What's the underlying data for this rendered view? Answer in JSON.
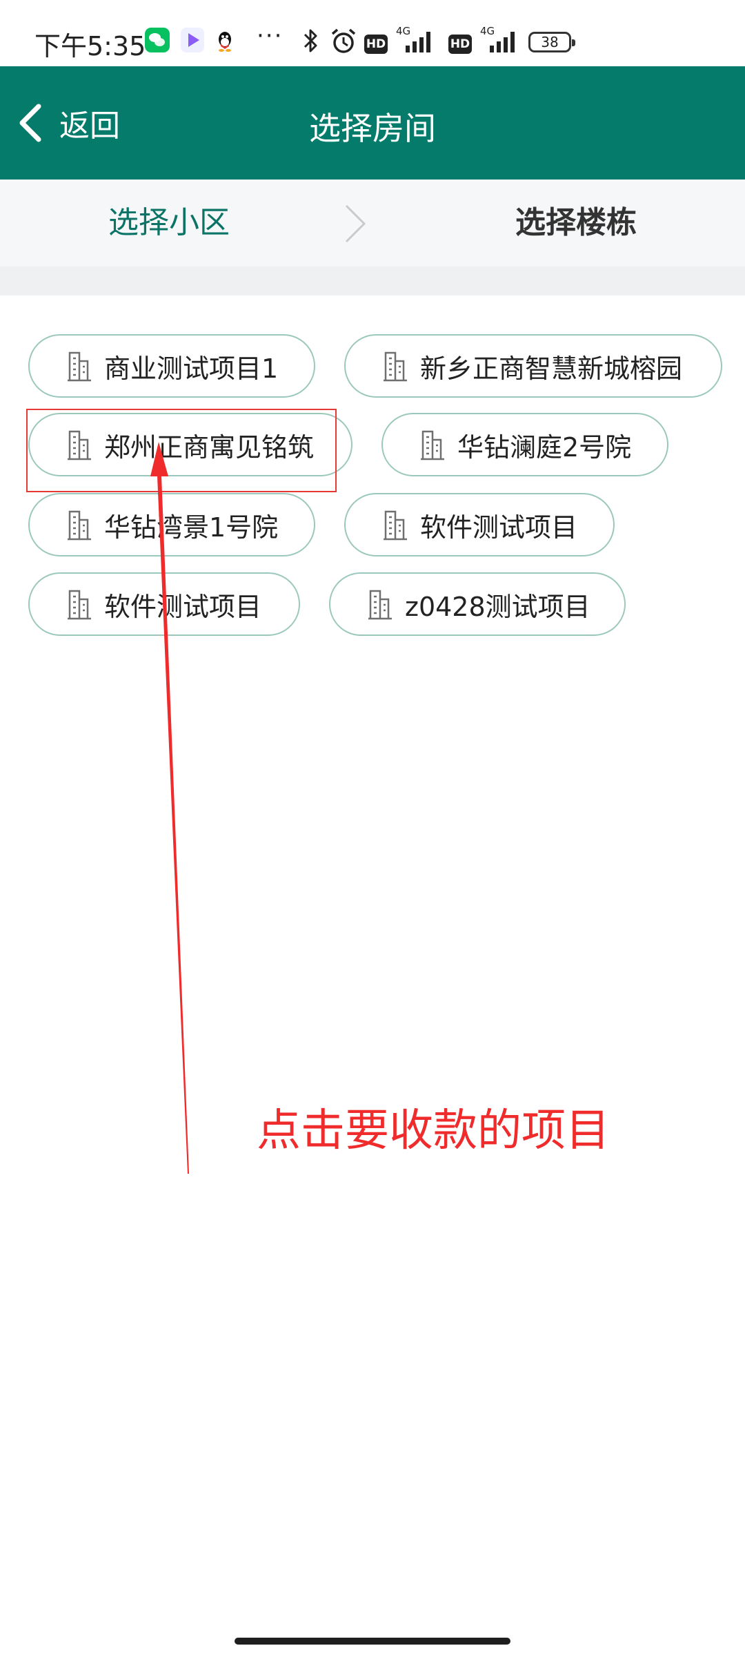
{
  "status_bar": {
    "time": "下午5:35",
    "network_1": "4G",
    "network_2": "4G",
    "hd_1": "HD",
    "hd_2": "HD",
    "battery": "38",
    "more": "···"
  },
  "header": {
    "back_label": "返回",
    "title": "选择房间",
    "color": "#057b6b"
  },
  "breadcrumb": {
    "community": "选择小区",
    "building": "选择楼栋"
  },
  "projects": [
    {
      "label": "商业测试项目1"
    },
    {
      "label": "新乡正商智慧新城榕园"
    },
    {
      "label": "郑州正商寓见铭筑"
    },
    {
      "label": "华钻澜庭2号院"
    },
    {
      "label": "华钻湾景1号院"
    },
    {
      "label": "软件测试项目"
    },
    {
      "label": "软件测试项目"
    },
    {
      "label": "z0428测试项目"
    }
  ],
  "annotation": {
    "text": "点击要收款的项目",
    "color": "#ef2b2b",
    "highlighted_project": "郑州正商寓见铭筑"
  }
}
